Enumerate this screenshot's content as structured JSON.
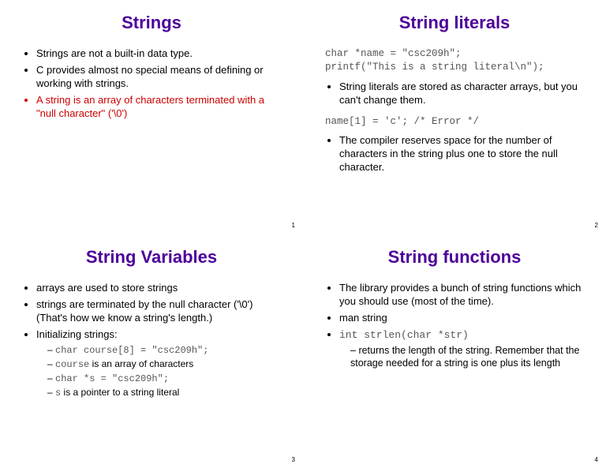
{
  "slide1": {
    "title": "Strings",
    "b1": "Strings are not a built-in data type.",
    "b2": "C provides almost no special means of defining or working with strings.",
    "b3": "A string is an array of characters terminated with a \"null character\" ('\\0')",
    "page": "1"
  },
  "slide2": {
    "title": "String literals",
    "code1": "char *name = \"csc209h\";\nprintf(\"This is a string literal\\n\");",
    "b1": "String literals are stored as character arrays, but you can't change them.",
    "code2": "name[1] = 'c'; /* Error */",
    "b2": "The compiler reserves space for the number of characters in the string plus one to store the null character.",
    "page": "2"
  },
  "slide3": {
    "title": "String Variables",
    "b1": "arrays are used to store strings",
    "b2": "strings are terminated by the null character ('\\0') (That's how we know a string's length.)",
    "b3": "Initializing strings:",
    "s1_code": "char course[8] = \"csc209h\";",
    "s2_a": "course",
    "s2_b": " is an array of characters",
    "s3_code": "char *s = \"csc209h\";",
    "s4_a": "s",
    "s4_b": " is a pointer to a string literal",
    "page": "3"
  },
  "slide4": {
    "title": "String functions",
    "b1": "The library provides a bunch of string functions which you should use (most of the time).",
    "b2": "man string",
    "b3_code": "int strlen(char *str)",
    "s1": "returns the length of the string.  Remember that the storage needed for a string is one plus its length",
    "page": "4"
  }
}
